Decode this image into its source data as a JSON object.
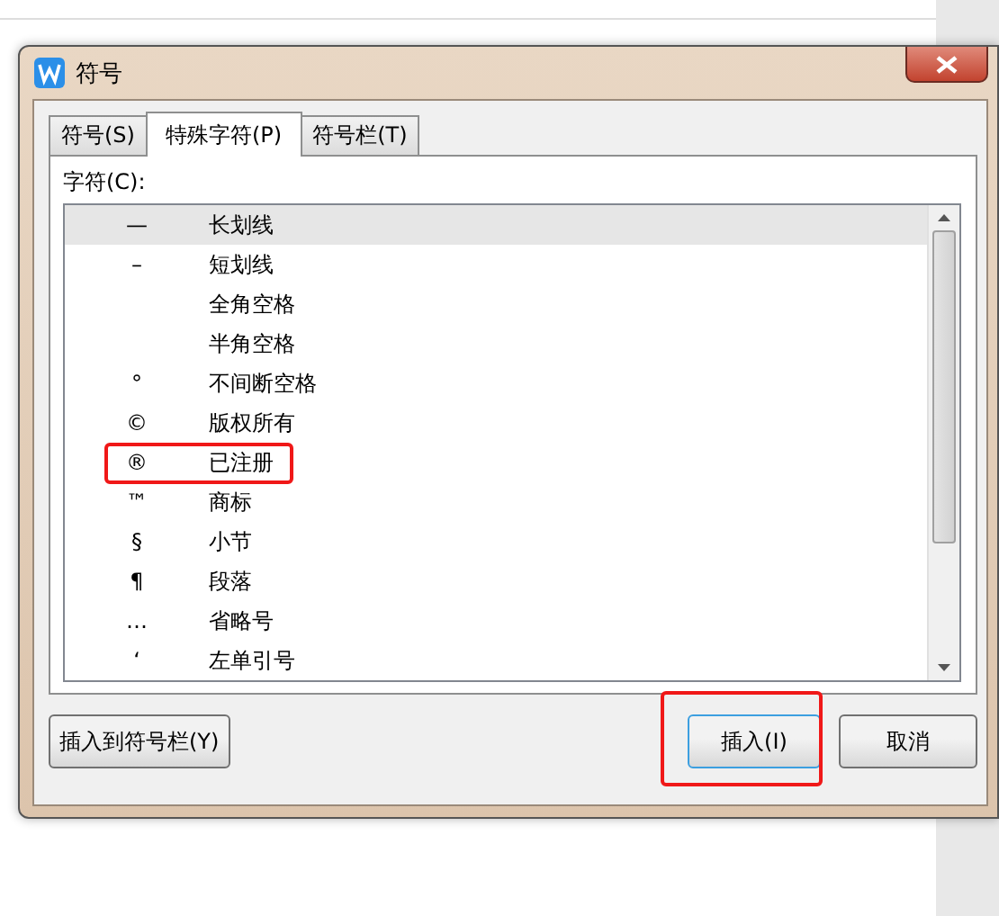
{
  "dialog": {
    "title": "符号"
  },
  "tabs": [
    {
      "label": "符号(S)",
      "selected": false
    },
    {
      "label": "特殊字符(P)",
      "selected": true
    },
    {
      "label": "符号栏(T)",
      "selected": false
    }
  ],
  "list_label": "字符(C):",
  "characters": [
    {
      "symbol": "—",
      "name": "长划线",
      "selected": true,
      "highlighted": false
    },
    {
      "symbol": "–",
      "name": "短划线",
      "selected": false,
      "highlighted": false
    },
    {
      "name": "全角空格",
      "selected": false,
      "highlighted": false
    },
    {
      "name": "半角空格",
      "selected": false,
      "highlighted": false
    },
    {
      "symbol": "°",
      "name": "不间断空格",
      "selected": false,
      "highlighted": false
    },
    {
      "symbol": "©",
      "name": "版权所有",
      "selected": false,
      "highlighted": false
    },
    {
      "symbol": "®",
      "name": "已注册",
      "selected": false,
      "highlighted": true
    },
    {
      "symbol": "™",
      "name": "商标",
      "selected": false,
      "highlighted": false
    },
    {
      "symbol": "§",
      "name": "小节",
      "selected": false,
      "highlighted": false
    },
    {
      "symbol": "¶",
      "name": "段落",
      "selected": false,
      "highlighted": false
    },
    {
      "symbol": "…",
      "name": "省略号",
      "selected": false,
      "highlighted": false
    },
    {
      "symbol": "‘",
      "name": "左单引号",
      "selected": false,
      "highlighted": false
    }
  ],
  "buttons": [
    {
      "label": "插入到符号栏(Y)",
      "kind": "secondary",
      "highlighted": false
    },
    {
      "label": "插入(I)",
      "kind": "default",
      "highlighted": true
    },
    {
      "label": "取消",
      "kind": "secondary",
      "highlighted": false
    }
  ]
}
